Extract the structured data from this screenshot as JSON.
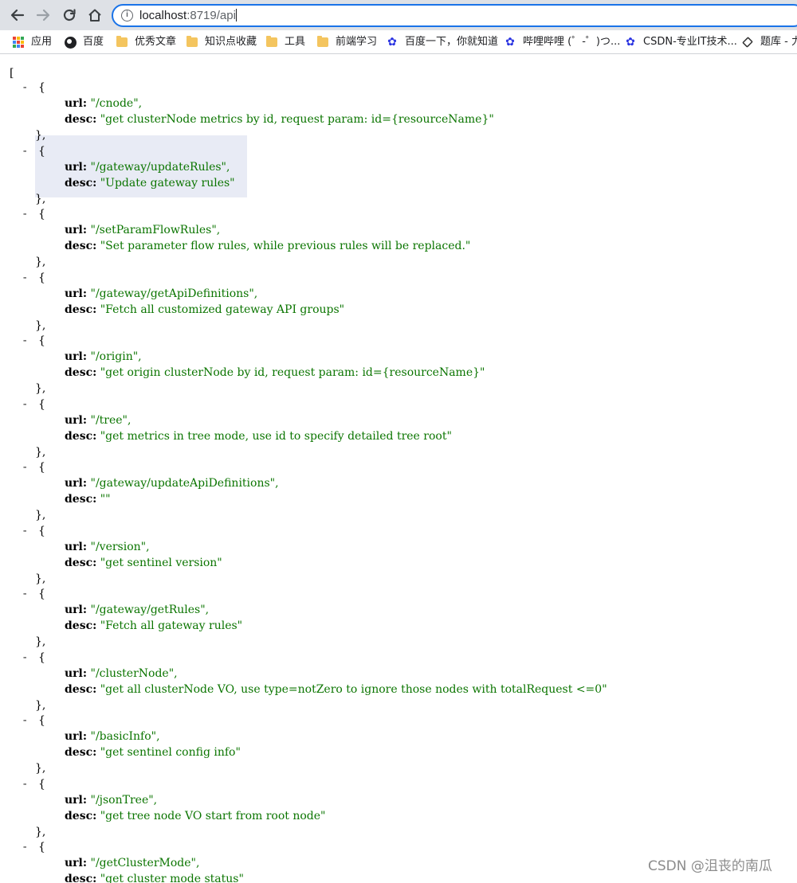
{
  "browser": {
    "address_host": "localhost",
    "address_rest": ":8719/api",
    "bookmarks": [
      {
        "label": "应用",
        "icon": "apps-grid-icon"
      },
      {
        "label": "百度",
        "icon": "globe-icon"
      },
      {
        "label": "优秀文章",
        "icon": "folder-icon"
      },
      {
        "label": "知识点收藏",
        "icon": "folder-icon"
      },
      {
        "label": "工具",
        "icon": "folder-icon"
      },
      {
        "label": "前端学习",
        "icon": "folder-icon"
      },
      {
        "label": "百度一下，你就知道",
        "icon": "baidu-paw-icon"
      },
      {
        "label": "哔哩哔哩 (゜-゜)つ...",
        "icon": "baidu-paw-icon"
      },
      {
        "label": "CSDN-专业IT技术...",
        "icon": "baidu-paw-icon"
      },
      {
        "label": "题库 - 力",
        "icon": "leetcode-icon"
      }
    ]
  },
  "json_view": {
    "open_bracket": "[",
    "collapse_symbol": "-",
    "open_brace": "{",
    "close_brace": "},",
    "url_key": "url:",
    "desc_key": "desc:",
    "entries": [
      {
        "url": "\"/cnode\",",
        "desc": "\"get clusterNode metrics by id, request param: id={resourceName}\""
      },
      {
        "url": "\"/gateway/updateRules\",",
        "desc": "\"Update gateway rules\""
      },
      {
        "url": "\"/setParamFlowRules\",",
        "desc": "\"Set parameter flow rules, while previous rules will be replaced.\""
      },
      {
        "url": "\"/gateway/getApiDefinitions\",",
        "desc": "\"Fetch all customized gateway API groups\""
      },
      {
        "url": "\"/origin\",",
        "desc": "\"get origin clusterNode by id, request param: id={resourceName}\""
      },
      {
        "url": "\"/tree\",",
        "desc": "\"get metrics in tree mode, use id to specify detailed tree root\""
      },
      {
        "url": "\"/gateway/updateApiDefinitions\",",
        "desc": "\"\""
      },
      {
        "url": "\"/version\",",
        "desc": "\"get sentinel version\""
      },
      {
        "url": "\"/gateway/getRules\",",
        "desc": "\"Fetch all gateway rules\""
      },
      {
        "url": "\"/clusterNode\",",
        "desc": "\"get all clusterNode VO, use type=notZero to ignore those nodes with totalRequest <=0\""
      },
      {
        "url": "\"/basicInfo\",",
        "desc": "\"get sentinel config info\""
      },
      {
        "url": "\"/jsonTree\",",
        "desc": "\"get tree node VO start from root node\""
      },
      {
        "url": "\"/getClusterMode\",",
        "desc": "\"get cluster mode status\""
      }
    ],
    "highlighted_entry": 1
  },
  "watermark": "CSDN @沮丧的南瓜"
}
